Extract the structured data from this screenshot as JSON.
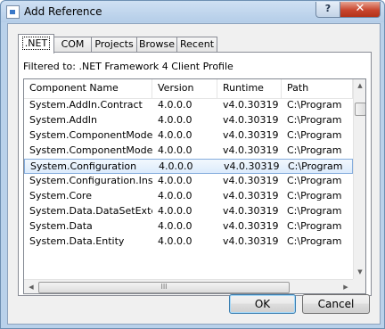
{
  "window": {
    "title": "Add Reference",
    "help_label": "?",
    "close_label": "✕"
  },
  "tabs": [
    {
      "label": ".NET",
      "active": true
    },
    {
      "label": "COM",
      "active": false
    },
    {
      "label": "Projects",
      "active": false
    },
    {
      "label": "Browse",
      "active": false
    },
    {
      "label": "Recent",
      "active": false
    }
  ],
  "filter_text": "Filtered to: .NET Framework 4 Client Profile",
  "list": {
    "columns": [
      "Component Name",
      "Version",
      "Runtime",
      "Path"
    ],
    "rows": [
      [
        "System.AddIn.Contract",
        "4.0.0.0",
        "v4.0.30319",
        "C:\\Program"
      ],
      [
        "System.AddIn",
        "4.0.0.0",
        "v4.0.30319",
        "C:\\Program"
      ],
      [
        "System.ComponentModel...",
        "4.0.0.0",
        "v4.0.30319",
        "C:\\Program"
      ],
      [
        "System.ComponentModel...",
        "4.0.0.0",
        "v4.0.30319",
        "C:\\Program"
      ],
      [
        "System.Configuration",
        "4.0.0.0",
        "v4.0.30319",
        "C:\\Program"
      ],
      [
        "System.Configuration.Install",
        "4.0.0.0",
        "v4.0.30319",
        "C:\\Program"
      ],
      [
        "System.Core",
        "4.0.0.0",
        "v4.0.30319",
        "C:\\Program"
      ],
      [
        "System.Data.DataSetExtens...",
        "4.0.0.0",
        "v4.0.30319",
        "C:\\Program"
      ],
      [
        "System.Data",
        "4.0.0.0",
        "v4.0.30319",
        "C:\\Program"
      ],
      [
        "System.Data.Entity",
        "4.0.0.0",
        "v4.0.30319",
        "C:\\Program"
      ]
    ],
    "selected_index": 4,
    "hscroll_grip": "III"
  },
  "buttons": {
    "ok": "OK",
    "cancel": "Cancel"
  },
  "colors": {
    "selection": "#dcebfc",
    "close": "#c8452d",
    "title_bar": "#b9d1ea"
  }
}
